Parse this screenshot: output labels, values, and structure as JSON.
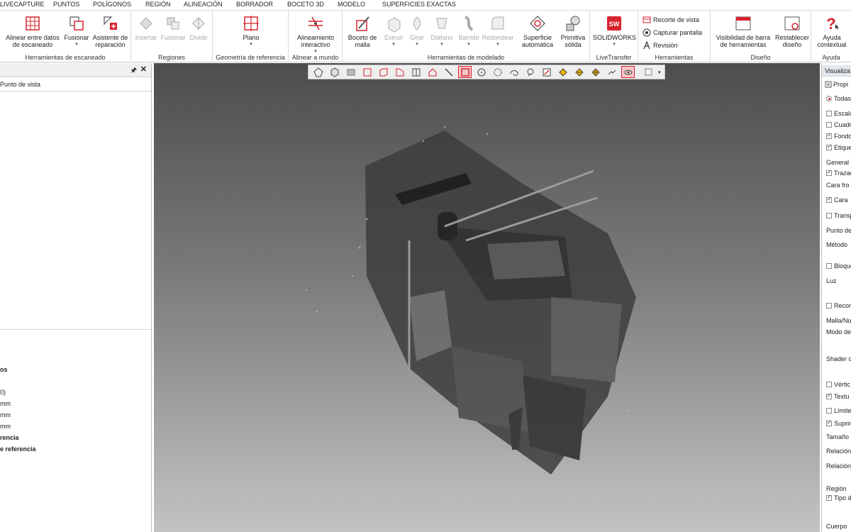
{
  "menu": [
    "LIVECAPTURE",
    "PUNTOS",
    "POLÍGONOS",
    "REGIÓN",
    "ALINEACIÓN",
    "BORRADOR",
    "BOCETO 3D",
    "MODELO",
    "SUPERFICIES EXACTAS"
  ],
  "ribbon": {
    "scan_tools": {
      "label": "Herramientas de escaneado",
      "align": "Alinear entre datos de escaneado",
      "merge": "Fusionar",
      "repair": "Asistente de reparación"
    },
    "regions": {
      "label": "Regiones",
      "insert": "Insertar",
      "merge": "Fusionar",
      "split": "Dividir"
    },
    "ref_geom": {
      "label": "Geometría de referencia",
      "plane": "Plano"
    },
    "align_world": {
      "label": "Alinear a mundo",
      "interactive": "Alineamiento interactivo"
    },
    "modeling": {
      "label": "Herramientas de modelado",
      "mesh_sketch": "Boceto de malla",
      "extrude": "Extruir",
      "revolve": "Girar",
      "loft": "Diáfano",
      "sweep": "Barrido",
      "fillet": "Redondear",
      "auto_surface": "Superficie automática",
      "solid_primitive": "Primitiva sólida"
    },
    "livetransfer": {
      "label": "LiveTransfer",
      "solidworks": "SOLIDWORKS"
    },
    "tools": {
      "label": "Herramientas",
      "view_clip": "Recorte de vista",
      "capture": "Capturar pantalla",
      "review": "Revisión"
    },
    "design": {
      "label": "Diseño",
      "toolbar_vis": "Visibilidad de barra de herramientas",
      "reset": "Restablecer diseño"
    },
    "help": {
      "label": "Ayuda",
      "context": "Ayuda contextual"
    }
  },
  "left_panel": {
    "viewpoint": "Punto de vista",
    "rows": [
      "os",
      "0)",
      "mm",
      "mm",
      "mm",
      "rencia",
      "e referencia"
    ]
  },
  "right_panel": {
    "title": "Visualiza",
    "props": "Propi",
    "all": "Todas",
    "items": [
      {
        "label": "Escala",
        "checked": false
      },
      {
        "label": "Cuadr",
        "checked": false
      },
      {
        "label": "Fondo",
        "checked": true
      },
      {
        "label": "Etique",
        "checked": true
      },
      {
        "label": "General",
        "checked": null
      },
      {
        "label": "Trazad",
        "checked": true
      },
      {
        "label": "Cara fro",
        "checked": null
      },
      {
        "label": "Cara",
        "checked": true
      },
      {
        "label": "Transp",
        "checked": false
      },
      {
        "label": "Punto de",
        "checked": null
      },
      {
        "label": "Método",
        "checked": null
      },
      {
        "label": "Bloque",
        "checked": false
      },
      {
        "label": "Luz",
        "checked": null
      },
      {
        "label": "Recor",
        "checked": false
      },
      {
        "label": "Malla/Nu",
        "checked": null
      },
      {
        "label": "Modo de",
        "checked": null
      },
      {
        "label": "Shader d",
        "checked": null
      },
      {
        "label": "Vértic",
        "checked": false
      },
      {
        "label": "Textu",
        "checked": true
      },
      {
        "label": "Límite",
        "checked": false
      },
      {
        "label": "Suprim",
        "checked": true
      },
      {
        "label": "Tamaño",
        "checked": null
      },
      {
        "label": "Relación",
        "checked": null
      },
      {
        "label": "Relación estática",
        "checked": null
      },
      {
        "label": "Región",
        "checked": null
      },
      {
        "label": "Tipo d",
        "checked": true
      },
      {
        "label": "Cuerpo",
        "checked": null
      }
    ]
  },
  "colors": {
    "accent": "#d9232e",
    "viewport_top": "#4d4d4d",
    "viewport_bottom": "#c3c3c3"
  }
}
